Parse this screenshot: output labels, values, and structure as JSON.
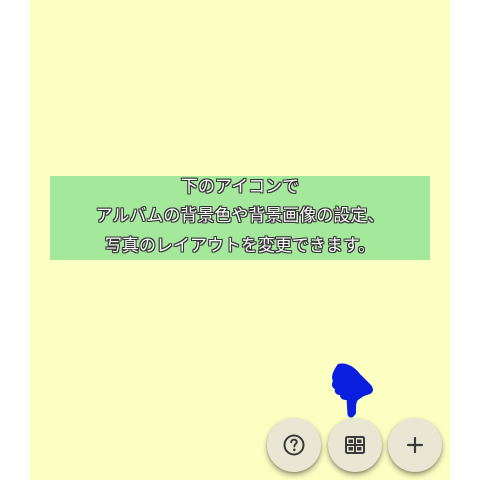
{
  "hint": {
    "line1": "下のアイコンで",
    "line2": "アルバムの背景色や背景画像の設定、",
    "line3": "写真のレイアウトを変更できます。"
  },
  "colors": {
    "album_background": "#fcffc2",
    "hint_background": "#a4e89c",
    "fab_background": "#e9e7d4",
    "pointer": "#0a1ee0",
    "icon": "#3a3a3a"
  },
  "fabs": [
    {
      "icon": "help-circle-icon"
    },
    {
      "icon": "grid-layout-icon"
    },
    {
      "icon": "plus-icon"
    }
  ],
  "pointer": {
    "icon": "pointing-hand-icon"
  }
}
